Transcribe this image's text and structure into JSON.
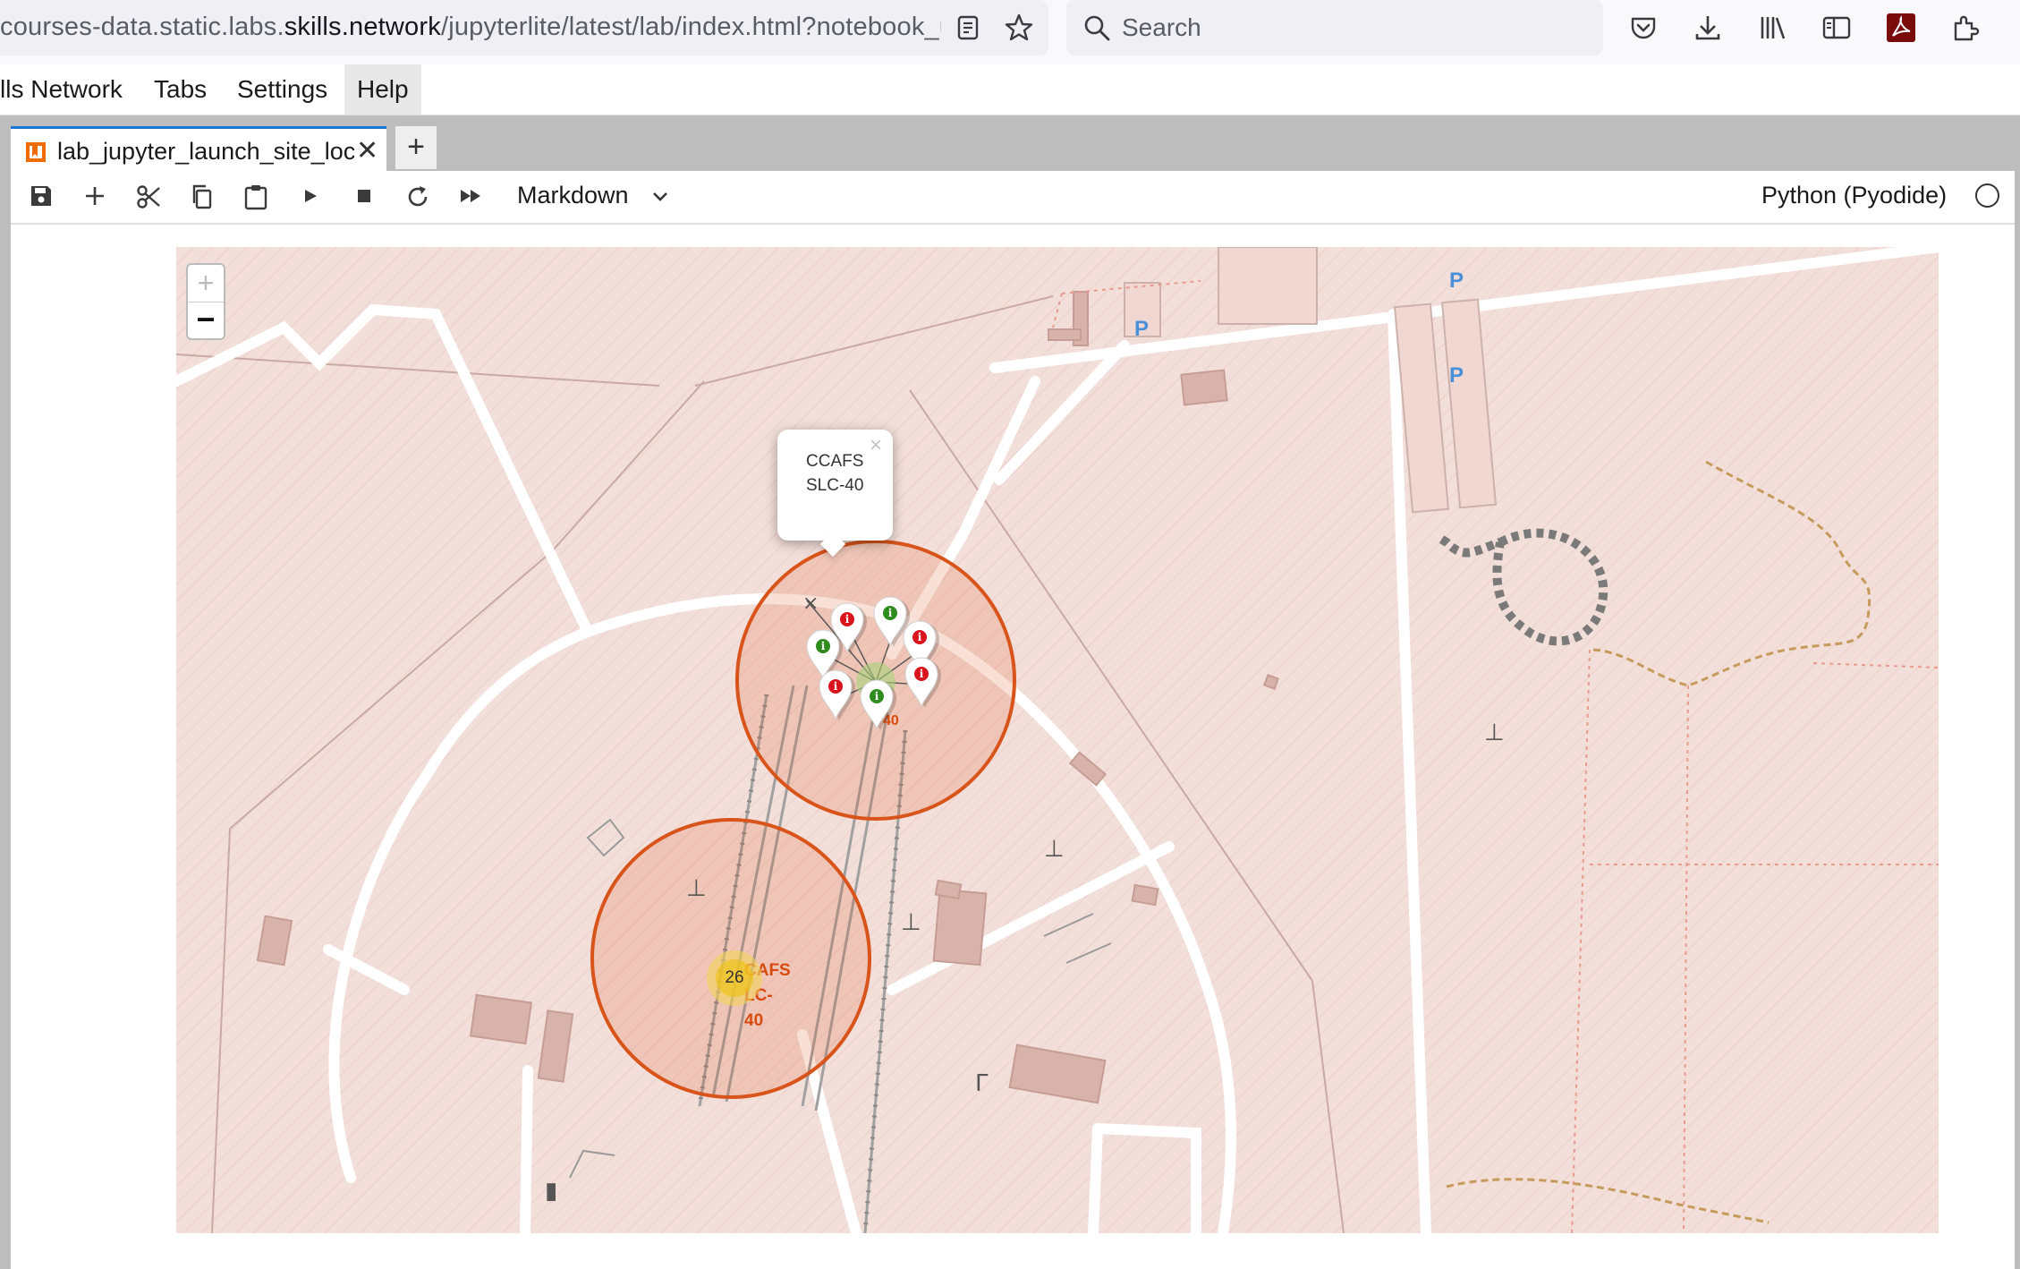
{
  "browser": {
    "url_prefix": "courses-data.static.labs.",
    "url_domain": "skills.network",
    "url_path": "/jupyterlite/latest/lab/index.html?notebook_ur",
    "search_placeholder": "Search"
  },
  "menu": {
    "items": [
      "lls Network",
      "Tabs",
      "Settings",
      "Help"
    ]
  },
  "tabs": {
    "notebook_tab_label": "lab_jupyter_launch_site_location",
    "close_glyph": "✕",
    "new_tab_glyph": "+"
  },
  "toolbar": {
    "cell_type": "Markdown",
    "kernel": "Python (Pyodide)"
  },
  "map": {
    "zoom_in": "+",
    "zoom_out": "−",
    "popup": {
      "text": "CCAFS SLC-40",
      "close": "×"
    },
    "cluster_count": "26",
    "site_label_lc40": [
      "CAFS",
      "LC-",
      "40"
    ],
    "parking_labels": [
      "P",
      "P",
      "P"
    ],
    "marker_glyph": "i",
    "marker_colors": {
      "success": "#2e8b1e",
      "failure": "#d9141c"
    },
    "markers": [
      {
        "status": "failure"
      },
      {
        "status": "success"
      },
      {
        "status": "failure"
      },
      {
        "status": "success"
      },
      {
        "status": "failure"
      },
      {
        "status": "failure"
      },
      {
        "status": "success"
      }
    ],
    "circle_color": "#d9541a"
  }
}
